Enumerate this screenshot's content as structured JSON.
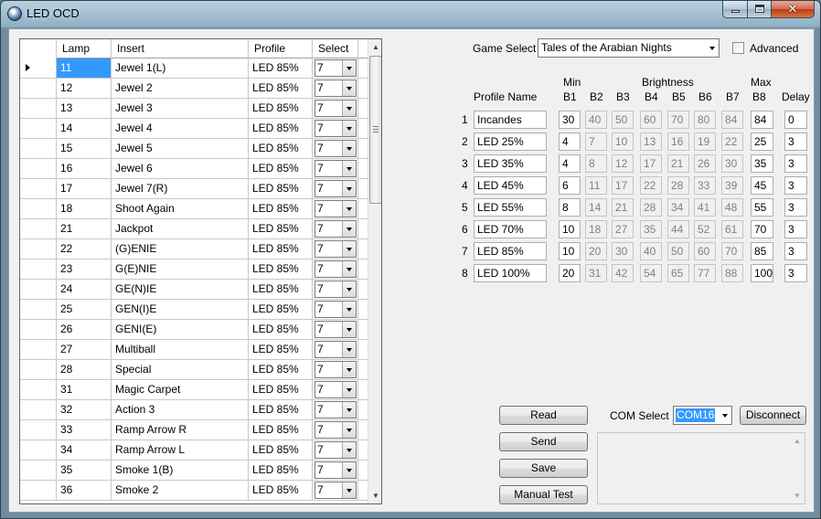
{
  "window": {
    "title": "LED OCD"
  },
  "grid": {
    "headers": {
      "lamp": "Lamp",
      "insert": "Insert",
      "profile": "Profile",
      "select": "Select"
    },
    "rows": [
      {
        "lamp": "11",
        "insert": "Jewel 1(L)",
        "profile": "LED 85%",
        "select": "7"
      },
      {
        "lamp": "12",
        "insert": "Jewel 2",
        "profile": "LED 85%",
        "select": "7"
      },
      {
        "lamp": "13",
        "insert": "Jewel 3",
        "profile": "LED 85%",
        "select": "7"
      },
      {
        "lamp": "14",
        "insert": "Jewel 4",
        "profile": "LED 85%",
        "select": "7"
      },
      {
        "lamp": "15",
        "insert": "Jewel 5",
        "profile": "LED 85%",
        "select": "7"
      },
      {
        "lamp": "16",
        "insert": "Jewel 6",
        "profile": "LED 85%",
        "select": "7"
      },
      {
        "lamp": "17",
        "insert": "Jewel 7(R)",
        "profile": "LED 85%",
        "select": "7"
      },
      {
        "lamp": "18",
        "insert": "Shoot Again",
        "profile": "LED 85%",
        "select": "7"
      },
      {
        "lamp": "21",
        "insert": "Jackpot",
        "profile": "LED 85%",
        "select": "7"
      },
      {
        "lamp": "22",
        "insert": "(G)ENIE",
        "profile": "LED 85%",
        "select": "7"
      },
      {
        "lamp": "23",
        "insert": "G(E)NIE",
        "profile": "LED 85%",
        "select": "7"
      },
      {
        "lamp": "24",
        "insert": "GE(N)IE",
        "profile": "LED 85%",
        "select": "7"
      },
      {
        "lamp": "25",
        "insert": "GEN(I)E",
        "profile": "LED 85%",
        "select": "7"
      },
      {
        "lamp": "26",
        "insert": "GENI(E)",
        "profile": "LED 85%",
        "select": "7"
      },
      {
        "lamp": "27",
        "insert": "Multiball",
        "profile": "LED 85%",
        "select": "7"
      },
      {
        "lamp": "28",
        "insert": "Special",
        "profile": "LED 85%",
        "select": "7"
      },
      {
        "lamp": "31",
        "insert": "Magic Carpet",
        "profile": "LED 85%",
        "select": "7"
      },
      {
        "lamp": "32",
        "insert": "Action 3",
        "profile": "LED 85%",
        "select": "7"
      },
      {
        "lamp": "33",
        "insert": "Ramp Arrow R",
        "profile": "LED 85%",
        "select": "7"
      },
      {
        "lamp": "34",
        "insert": "Ramp Arrow L",
        "profile": "LED 85%",
        "select": "7"
      },
      {
        "lamp": "35",
        "insert": "Smoke 1(B)",
        "profile": "LED 85%",
        "select": "7"
      },
      {
        "lamp": "36",
        "insert": "Smoke 2",
        "profile": "LED 85%",
        "select": "7"
      }
    ]
  },
  "game_select": {
    "label": "Game Select",
    "value": "Tales of the Arabian Nights"
  },
  "advanced": {
    "label": "Advanced",
    "checked": false
  },
  "profiles": {
    "header": {
      "min": "Min",
      "brightness": "Brightness",
      "max": "Max",
      "profile_name": "Profile Name",
      "b1": "B1",
      "b2": "B2",
      "b3": "B3",
      "b4": "B4",
      "b5": "B5",
      "b6": "B6",
      "b7": "B7",
      "b8": "B8",
      "delay": "Delay"
    },
    "rows": [
      {
        "index": "1",
        "name": "Incandes",
        "b1": "30",
        "b2": "40",
        "b3": "50",
        "b4": "60",
        "b5": "70",
        "b6": "80",
        "b7": "84",
        "b8": "84",
        "delay": "0"
      },
      {
        "index": "2",
        "name": "LED 25%",
        "b1": "4",
        "b2": "7",
        "b3": "10",
        "b4": "13",
        "b5": "16",
        "b6": "19",
        "b7": "22",
        "b8": "25",
        "delay": "3"
      },
      {
        "index": "3",
        "name": "LED 35%",
        "b1": "4",
        "b2": "8",
        "b3": "12",
        "b4": "17",
        "b5": "21",
        "b6": "26",
        "b7": "30",
        "b8": "35",
        "delay": "3"
      },
      {
        "index": "4",
        "name": "LED 45%",
        "b1": "6",
        "b2": "11",
        "b3": "17",
        "b4": "22",
        "b5": "28",
        "b6": "33",
        "b7": "39",
        "b8": "45",
        "delay": "3"
      },
      {
        "index": "5",
        "name": "LED 55%",
        "b1": "8",
        "b2": "14",
        "b3": "21",
        "b4": "28",
        "b5": "34",
        "b6": "41",
        "b7": "48",
        "b8": "55",
        "delay": "3"
      },
      {
        "index": "6",
        "name": "LED 70%",
        "b1": "10",
        "b2": "18",
        "b3": "27",
        "b4": "35",
        "b5": "44",
        "b6": "52",
        "b7": "61",
        "b8": "70",
        "delay": "3"
      },
      {
        "index": "7",
        "name": "LED 85%",
        "b1": "10",
        "b2": "20",
        "b3": "30",
        "b4": "40",
        "b5": "50",
        "b6": "60",
        "b7": "70",
        "b8": "85",
        "delay": "3"
      },
      {
        "index": "8",
        "name": "LED 100%",
        "b1": "20",
        "b2": "31",
        "b3": "42",
        "b4": "54",
        "b5": "65",
        "b6": "77",
        "b7": "88",
        "b8": "100",
        "delay": "3"
      }
    ]
  },
  "buttons": {
    "read": "Read",
    "send": "Send",
    "save": "Save",
    "manual_test": "Manual Test",
    "disconnect": "Disconnect"
  },
  "com_select": {
    "label": "COM Select",
    "value": "COM16"
  },
  "colors": {
    "selection": "#3399ff",
    "face": "#f0f0f0"
  }
}
